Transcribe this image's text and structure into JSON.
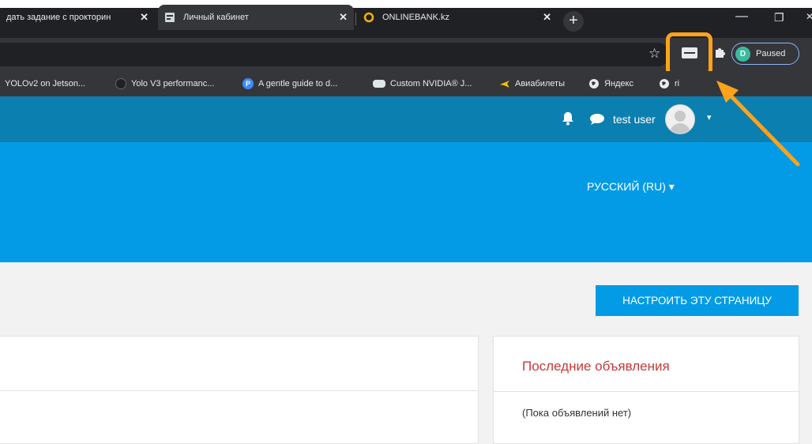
{
  "browser": {
    "tabs": [
      {
        "title": "дать задание с прокторин",
        "active": false
      },
      {
        "title": "Личный кабинет",
        "active": true
      },
      {
        "title": "ONLINEBANK.kz",
        "active": false
      }
    ],
    "new_tab_label": "+",
    "window_controls": {
      "minimize": "—",
      "restore": "❐",
      "close": "✕"
    },
    "star_icon": "☆",
    "profile": {
      "initial": "D",
      "label": "Paused"
    },
    "bookmarks": [
      {
        "label": "YOLOv2 on Jetson...",
        "icon": "none"
      },
      {
        "label": "Yolo V3 performanc...",
        "icon": "github-icon"
      },
      {
        "label": "A gentle guide to d...",
        "icon": "p-icon"
      },
      {
        "label": "Custom NVIDIA® J...",
        "icon": "nvidia-icon"
      },
      {
        "label": "Авиабилеты",
        "icon": "plane-icon"
      },
      {
        "label": "Яндекс",
        "icon": "globe-icon"
      },
      {
        "label": "ri",
        "icon": "globe-icon"
      }
    ]
  },
  "navbar": {
    "user_name": "test user",
    "caret": "▾"
  },
  "banner": {
    "language": "РУССКИЙ (RU) ▾"
  },
  "page": {
    "customize_button": "НАСТРОИТЬ ЭТУ СТРАНИЦУ",
    "news": {
      "title": "Последние объявления",
      "empty": "(Пока объявлений нет)"
    }
  },
  "colors": {
    "navbar": "#0b7fb0",
    "banner": "#039be5",
    "highlight": "#ffa31a",
    "news_title": "#c73a3a"
  }
}
